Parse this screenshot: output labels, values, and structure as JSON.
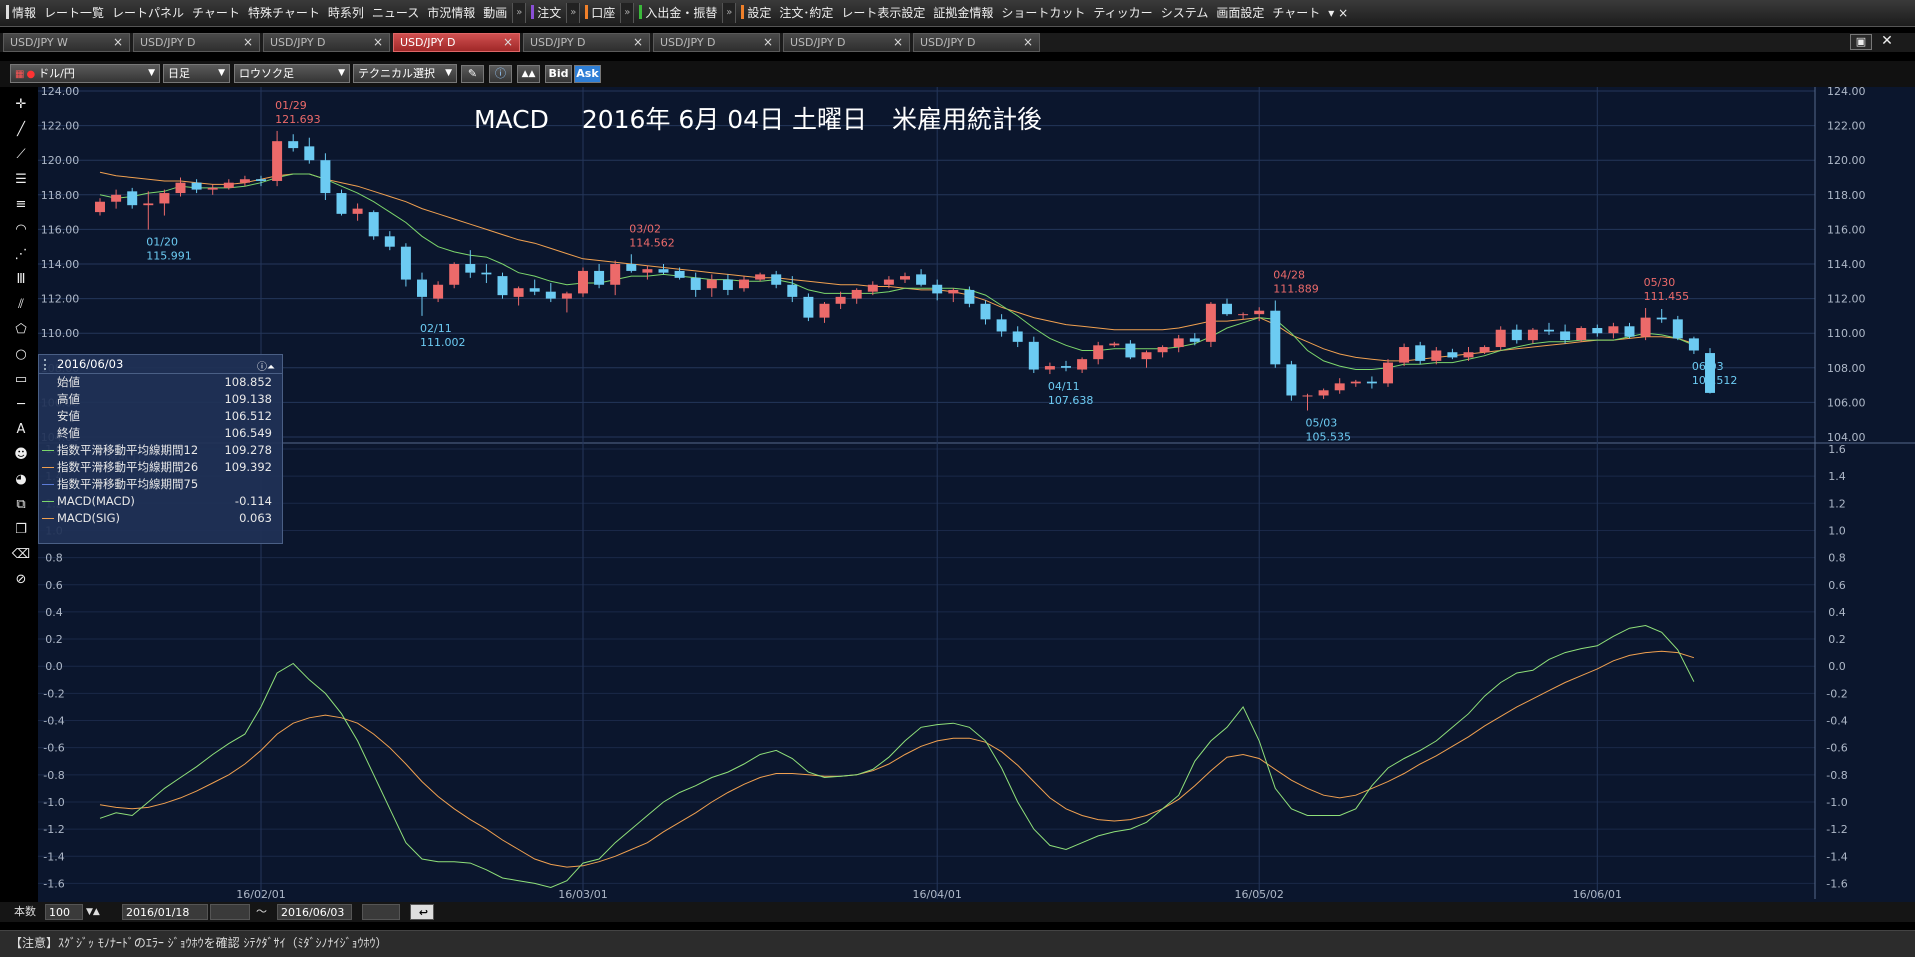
{
  "menu": {
    "items": [
      "情報",
      "レート一覧",
      "レートパネル",
      "チャート",
      "特殊チャート",
      "時系列",
      "ニュース",
      "市況情報",
      "動画",
      "注文",
      "口座",
      "入出金・振替",
      "設定",
      "注文･約定",
      "レート表示設定",
      "証拠金情報",
      "ショートカット",
      "ティッカー",
      "システム",
      "画面設定",
      "チャート"
    ]
  },
  "tabs": [
    {
      "label": "USD/JPY W"
    },
    {
      "label": "USD/JPY D"
    },
    {
      "label": "USD/JPY D"
    },
    {
      "label": "USD/JPY D"
    },
    {
      "label": "USD/JPY D"
    },
    {
      "label": "USD/JPY D"
    },
    {
      "label": "USD/JPY D"
    },
    {
      "label": "USD/JPY D"
    }
  ],
  "toolbar": {
    "pair": "ドル/円",
    "period": "日足",
    "chart_type": "ロウソク足",
    "technical": "テクニカル選択",
    "bid": "Bid",
    "ask": "Ask"
  },
  "chart_title": "MACD　 2016年 6月 04日 土曜日　米雇用統計後",
  "macd_label": "MACD",
  "colors": {
    "up": "#ec6a6a",
    "down": "#6ccbf2",
    "ema12": "#7cd66c",
    "ema26": "#f0a050",
    "macd": "#8fe07a",
    "signal": "#f0a050",
    "bg": "#0b162d",
    "grid": "#24365a"
  },
  "annotations": [
    {
      "date": "01/29",
      "price": "121.693",
      "kind": "high"
    },
    {
      "date": "01/20",
      "price": "115.991",
      "kind": "low"
    },
    {
      "date": "03/02",
      "price": "114.562",
      "kind": "high"
    },
    {
      "date": "02/11",
      "price": "111.002",
      "kind": "low"
    },
    {
      "date": "04/28",
      "price": "111.889",
      "kind": "high"
    },
    {
      "date": "04/11",
      "price": "107.638",
      "kind": "low"
    },
    {
      "date": "05/03",
      "price": "105.535",
      "kind": "low"
    },
    {
      "date": "05/30",
      "price": "111.455",
      "kind": "high"
    },
    {
      "date": "06/03",
      "price": "106.512",
      "kind": "low"
    }
  ],
  "info_panel": {
    "date": "2016/06/03",
    "rows": [
      {
        "label": "始値",
        "value": "108.852"
      },
      {
        "label": "高値",
        "value": "109.138"
      },
      {
        "label": "安値",
        "value": "106.512"
      },
      {
        "label": "終値",
        "value": "106.549"
      },
      {
        "label": "指数平滑移動平均線期間12",
        "value": "109.278"
      },
      {
        "label": "指数平滑移動平均線期間26",
        "value": "109.392"
      },
      {
        "label": "指数平滑移動平均線期間75",
        "value": ""
      },
      {
        "label": "MACD(MACD)",
        "value": "-0.114"
      },
      {
        "label": "MACD(SIG)",
        "value": "0.063"
      }
    ]
  },
  "bottom": {
    "count_label": "本数",
    "count_value": "100",
    "from_date": "2016/01/18",
    "tilde": "〜",
    "to_date": "2016/06/03"
  },
  "status_text": "【注意】ｽｸﾞｼﾞｯ ﾓﾉﾅｰﾄﾞのｴﾗｰ ｼﾞｮｳﾎｳを確認 ｼﾃｸﾀﾞｻｲ（ﾐﾀﾞｼﾉﾅｲｼﾞｮｳﾎｳ）",
  "chart_data": {
    "type": "candlestick",
    "ylim": [
      104,
      124
    ],
    "yticks": [
      "104.00",
      "106.00",
      "108.00",
      "110.00",
      "112.00",
      "114.00",
      "116.00",
      "118.00",
      "120.00",
      "122.00",
      "124.00"
    ],
    "macd_ylim": [
      -1.7,
      1.6
    ],
    "macd_yticks": [
      "-1.6",
      "-1.4",
      "-1.2",
      "-1.0",
      "-0.8",
      "-0.6",
      "-0.4",
      "-0.2",
      "0.0",
      "0.2",
      "0.4",
      "0.6",
      "0.8",
      "1.0",
      "1.2",
      "1.4",
      "1.6"
    ],
    "xticks": [
      {
        "label": "16/02/01",
        "index": 10
      },
      {
        "label": "16/03/01",
        "index": 30
      },
      {
        "label": "16/04/01",
        "index": 52
      },
      {
        "label": "16/05/02",
        "index": 72
      },
      {
        "label": "16/06/01",
        "index": 93
      }
    ],
    "candles": [
      [
        117.0,
        117.8,
        116.8,
        117.6
      ],
      [
        117.6,
        118.3,
        117.2,
        118.0
      ],
      [
        118.2,
        118.4,
        117.2,
        117.4
      ],
      [
        117.4,
        118.2,
        115.991,
        117.5
      ],
      [
        117.5,
        118.3,
        116.8,
        118.1
      ],
      [
        118.1,
        119.0,
        117.9,
        118.7
      ],
      [
        118.7,
        118.9,
        118.1,
        118.3
      ],
      [
        118.3,
        118.6,
        118.0,
        118.4
      ],
      [
        118.4,
        118.9,
        118.3,
        118.7
      ],
      [
        118.7,
        119.1,
        118.5,
        118.9
      ],
      [
        118.9,
        119.1,
        118.5,
        118.8
      ],
      [
        118.8,
        121.693,
        118.5,
        121.1
      ],
      [
        121.1,
        121.5,
        120.5,
        120.7
      ],
      [
        120.8,
        121.3,
        119.8,
        120.0
      ],
      [
        120.0,
        120.4,
        117.7,
        118.1
      ],
      [
        118.1,
        118.3,
        116.8,
        116.9
      ],
      [
        116.9,
        117.5,
        116.5,
        117.2
      ],
      [
        117.0,
        117.1,
        115.4,
        115.6
      ],
      [
        115.6,
        115.9,
        114.8,
        115.0
      ],
      [
        115.0,
        115.2,
        112.7,
        113.1
      ],
      [
        113.1,
        113.5,
        111.002,
        112.1
      ],
      [
        112.0,
        113.0,
        111.8,
        112.8
      ],
      [
        112.8,
        114.1,
        112.6,
        114.0
      ],
      [
        114.0,
        114.8,
        113.2,
        113.5
      ],
      [
        113.5,
        114.0,
        112.9,
        113.4
      ],
      [
        113.3,
        113.5,
        112.0,
        112.2
      ],
      [
        112.1,
        112.7,
        111.6,
        112.6
      ],
      [
        112.6,
        113.1,
        112.2,
        112.4
      ],
      [
        112.4,
        112.9,
        111.8,
        112.0
      ],
      [
        112.0,
        112.4,
        111.2,
        112.3
      ],
      [
        112.3,
        113.8,
        112.1,
        113.6
      ],
      [
        113.6,
        114.0,
        112.6,
        112.8
      ],
      [
        112.8,
        114.2,
        112.2,
        114.0
      ],
      [
        114.0,
        114.562,
        113.5,
        113.6
      ],
      [
        113.5,
        113.9,
        113.1,
        113.7
      ],
      [
        113.7,
        114.0,
        113.4,
        113.5
      ],
      [
        113.6,
        113.8,
        113.1,
        113.2
      ],
      [
        113.2,
        113.5,
        112.1,
        112.5
      ],
      [
        112.6,
        113.4,
        112.1,
        113.1
      ],
      [
        113.1,
        113.4,
        112.2,
        112.5
      ],
      [
        112.6,
        113.3,
        112.4,
        113.1
      ],
      [
        113.1,
        113.5,
        113.0,
        113.4
      ],
      [
        113.4,
        113.6,
        112.6,
        112.8
      ],
      [
        112.8,
        113.3,
        111.8,
        112.1
      ],
      [
        112.1,
        112.3,
        110.7,
        110.9
      ],
      [
        110.9,
        111.8,
        110.6,
        111.7
      ],
      [
        111.7,
        112.4,
        111.4,
        112.1
      ],
      [
        112.0,
        112.6,
        111.7,
        112.5
      ],
      [
        112.4,
        113.0,
        112.2,
        112.8
      ],
      [
        112.8,
        113.3,
        112.6,
        113.1
      ],
      [
        113.1,
        113.5,
        112.9,
        113.3
      ],
      [
        113.4,
        113.7,
        112.7,
        112.8
      ],
      [
        112.8,
        113.1,
        111.9,
        112.3
      ],
      [
        112.3,
        112.6,
        111.8,
        112.5
      ],
      [
        112.5,
        112.7,
        111.5,
        111.7
      ],
      [
        111.7,
        111.9,
        110.5,
        110.8
      ],
      [
        110.8,
        111.1,
        109.8,
        110.1
      ],
      [
        110.1,
        110.4,
        109.2,
        109.5
      ],
      [
        109.5,
        109.8,
        107.7,
        107.9
      ],
      [
        107.9,
        108.3,
        107.638,
        108.1
      ],
      [
        108.1,
        108.4,
        107.8,
        108.0
      ],
      [
        107.9,
        108.6,
        107.7,
        108.5
      ],
      [
        108.5,
        109.5,
        108.2,
        109.3
      ],
      [
        109.3,
        109.5,
        109.2,
        109.4
      ],
      [
        109.4,
        109.6,
        108.5,
        108.6
      ],
      [
        108.5,
        109.0,
        108.0,
        108.9
      ],
      [
        108.9,
        109.3,
        108.6,
        109.2
      ],
      [
        109.2,
        109.9,
        108.9,
        109.7
      ],
      [
        109.7,
        110.0,
        109.3,
        109.5
      ],
      [
        109.5,
        111.8,
        109.2,
        111.7
      ],
      [
        111.7,
        112.0,
        111.0,
        111.1
      ],
      [
        111.1,
        111.2,
        110.8,
        111.1
      ],
      [
        111.1,
        111.5,
        110.7,
        111.3
      ],
      [
        111.3,
        111.889,
        108.0,
        108.2
      ],
      [
        108.2,
        108.4,
        106.1,
        106.4
      ],
      [
        106.4,
        106.5,
        105.535,
        106.4
      ],
      [
        106.4,
        106.8,
        106.2,
        106.7
      ],
      [
        106.7,
        107.4,
        106.5,
        107.1
      ],
      [
        107.1,
        107.3,
        106.9,
        107.2
      ],
      [
        107.2,
        107.5,
        106.8,
        107.1
      ],
      [
        107.1,
        108.5,
        106.9,
        108.3
      ],
      [
        108.3,
        109.4,
        108.1,
        109.2
      ],
      [
        109.3,
        109.5,
        108.2,
        108.4
      ],
      [
        108.4,
        109.2,
        108.2,
        109.0
      ],
      [
        108.9,
        109.1,
        108.5,
        108.6
      ],
      [
        108.6,
        109.2,
        108.4,
        108.9
      ],
      [
        108.9,
        109.3,
        108.8,
        109.2
      ],
      [
        109.2,
        110.4,
        109.0,
        110.2
      ],
      [
        110.2,
        110.5,
        109.4,
        109.6
      ],
      [
        109.6,
        110.3,
        109.4,
        110.2
      ],
      [
        110.2,
        110.6,
        109.9,
        110.1
      ],
      [
        110.1,
        110.5,
        109.4,
        109.6
      ],
      [
        109.6,
        110.4,
        109.5,
        110.3
      ],
      [
        110.3,
        110.5,
        109.8,
        110.0
      ],
      [
        110.0,
        110.6,
        109.7,
        110.4
      ],
      [
        110.4,
        110.6,
        109.7,
        109.8
      ],
      [
        109.8,
        111.455,
        109.6,
        110.9
      ],
      [
        110.9,
        111.4,
        110.6,
        110.8
      ],
      [
        110.8,
        111.0,
        109.6,
        109.7
      ],
      [
        109.7,
        109.8,
        108.8,
        109.0
      ],
      [
        108.852,
        109.138,
        106.512,
        106.549
      ]
    ],
    "ema12": [
      118.0,
      117.8,
      117.9,
      118.1,
      118.2,
      118.5,
      118.4,
      118.4,
      118.4,
      118.5,
      118.7,
      119.0,
      119.2,
      119.2,
      118.9,
      118.5,
      118.1,
      117.6,
      117.0,
      116.4,
      115.6,
      115.0,
      114.7,
      114.5,
      114.4,
      114.0,
      113.5,
      113.3,
      113.0,
      112.8,
      112.9,
      112.9,
      113.1,
      113.3,
      113.3,
      113.4,
      113.3,
      113.2,
      113.1,
      113.1,
      113.0,
      113.0,
      113.1,
      112.9,
      112.5,
      112.3,
      112.3,
      112.3,
      112.3,
      112.4,
      112.6,
      112.6,
      112.6,
      112.6,
      112.5,
      112.2,
      111.6,
      111.0,
      110.3,
      109.7,
      109.3,
      109.0,
      109.0,
      109.1,
      109.1,
      109.1,
      109.1,
      109.2,
      109.4,
      109.8,
      110.3,
      110.6,
      110.9,
      110.8,
      110.0,
      109.0,
      108.4,
      108.1,
      107.9,
      107.9,
      108.0,
      108.2,
      108.2,
      108.3,
      108.3,
      108.5,
      108.7,
      109.0,
      109.2,
      109.4,
      109.5,
      109.5,
      109.6,
      109.6,
      109.6,
      109.8,
      110.0,
      109.9,
      109.7,
      109.3
    ],
    "ema26": [
      119.3,
      119.1,
      119.0,
      118.9,
      118.8,
      118.8,
      118.7,
      118.6,
      118.6,
      118.7,
      118.9,
      119.1,
      119.2,
      119.2,
      118.9,
      118.7,
      118.5,
      118.2,
      117.9,
      117.6,
      117.2,
      116.9,
      116.6,
      116.3,
      116.0,
      115.7,
      115.4,
      115.2,
      114.9,
      114.6,
      114.3,
      114.2,
      114.1,
      114.0,
      113.9,
      113.8,
      113.7,
      113.6,
      113.5,
      113.4,
      113.3,
      113.2,
      113.2,
      113.1,
      113.0,
      112.9,
      112.8,
      112.8,
      112.7,
      112.7,
      112.6,
      112.5,
      112.5,
      112.4,
      112.2,
      111.9,
      111.5,
      111.2,
      110.9,
      110.7,
      110.5,
      110.4,
      110.3,
      110.2,
      110.2,
      110.2,
      110.2,
      110.3,
      110.5,
      110.7,
      110.7,
      110.8,
      110.9,
      110.5,
      109.9,
      109.5,
      109.1,
      108.8,
      108.6,
      108.5,
      108.4,
      108.4,
      108.5,
      108.6,
      108.7,
      108.8,
      108.9,
      109.0,
      109.1,
      109.2,
      109.3,
      109.4,
      109.5,
      109.6,
      109.6,
      109.7,
      109.8,
      109.8,
      109.7,
      109.4
    ],
    "macd": [
      -1.12,
      -1.08,
      -1.1,
      -1.0,
      -0.9,
      -0.82,
      -0.74,
      -0.65,
      -0.57,
      -0.5,
      -0.3,
      -0.05,
      0.02,
      -0.1,
      -0.2,
      -0.35,
      -0.55,
      -0.8,
      -1.05,
      -1.3,
      -1.42,
      -1.44,
      -1.44,
      -1.45,
      -1.5,
      -1.56,
      -1.58,
      -1.6,
      -1.63,
      -1.58,
      -1.45,
      -1.42,
      -1.3,
      -1.2,
      -1.1,
      -1.0,
      -0.93,
      -0.88,
      -0.82,
      -0.78,
      -0.72,
      -0.65,
      -0.62,
      -0.68,
      -0.78,
      -0.82,
      -0.81,
      -0.8,
      -0.76,
      -0.67,
      -0.55,
      -0.45,
      -0.43,
      -0.42,
      -0.45,
      -0.55,
      -0.75,
      -1.0,
      -1.2,
      -1.32,
      -1.35,
      -1.3,
      -1.25,
      -1.22,
      -1.2,
      -1.15,
      -1.05,
      -0.95,
      -0.7,
      -0.55,
      -0.45,
      -0.3,
      -0.55,
      -0.9,
      -1.05,
      -1.1,
      -1.1,
      -1.1,
      -1.05,
      -0.88,
      -0.75,
      -0.68,
      -0.62,
      -0.55,
      -0.45,
      -0.35,
      -0.22,
      -0.12,
      -0.05,
      -0.03,
      0.05,
      0.1,
      0.13,
      0.15,
      0.22,
      0.28,
      0.3,
      0.25,
      0.12,
      -0.114
    ],
    "signal": [
      -1.02,
      -1.04,
      -1.05,
      -1.04,
      -1.01,
      -0.97,
      -0.92,
      -0.86,
      -0.8,
      -0.72,
      -0.62,
      -0.5,
      -0.42,
      -0.38,
      -0.36,
      -0.38,
      -0.42,
      -0.5,
      -0.6,
      -0.72,
      -0.85,
      -0.96,
      -1.05,
      -1.13,
      -1.2,
      -1.28,
      -1.35,
      -1.42,
      -1.46,
      -1.48,
      -1.47,
      -1.44,
      -1.4,
      -1.35,
      -1.3,
      -1.22,
      -1.15,
      -1.08,
      -1.0,
      -0.93,
      -0.87,
      -0.82,
      -0.79,
      -0.79,
      -0.8,
      -0.81,
      -0.81,
      -0.8,
      -0.77,
      -0.72,
      -0.65,
      -0.59,
      -0.55,
      -0.53,
      -0.53,
      -0.56,
      -0.63,
      -0.73,
      -0.85,
      -0.97,
      -1.05,
      -1.1,
      -1.13,
      -1.14,
      -1.13,
      -1.1,
      -1.05,
      -0.98,
      -0.88,
      -0.77,
      -0.67,
      -0.65,
      -0.68,
      -0.76,
      -0.84,
      -0.9,
      -0.95,
      -0.97,
      -0.95,
      -0.9,
      -0.85,
      -0.79,
      -0.72,
      -0.66,
      -0.59,
      -0.52,
      -0.44,
      -0.37,
      -0.3,
      -0.24,
      -0.18,
      -0.12,
      -0.07,
      -0.02,
      0.04,
      0.08,
      0.1,
      0.11,
      0.1,
      0.063
    ]
  }
}
